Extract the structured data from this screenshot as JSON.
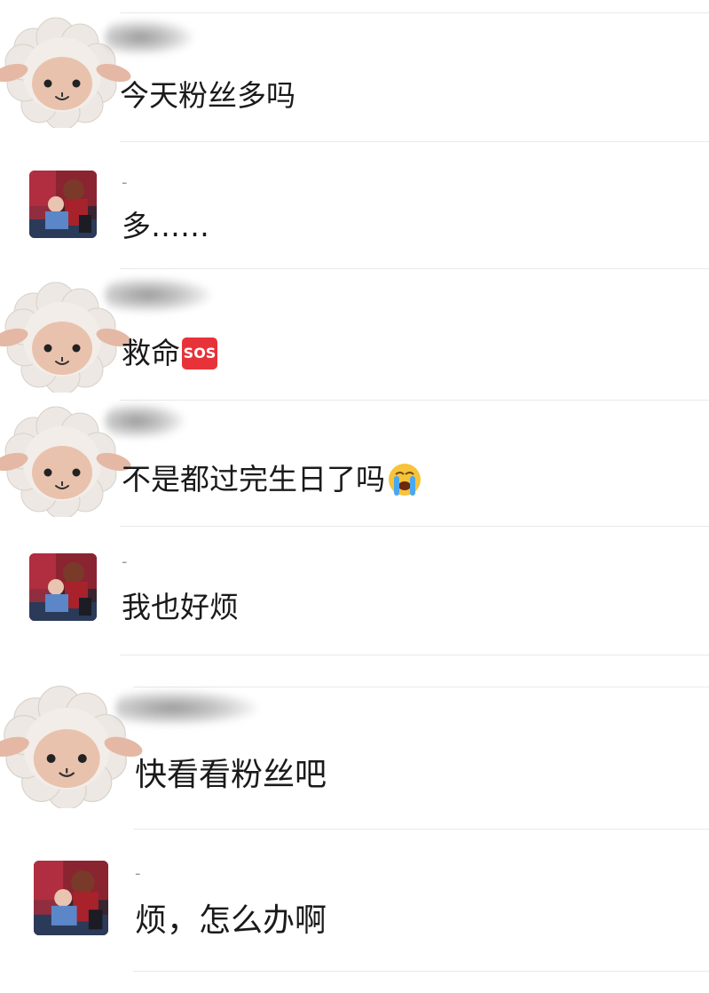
{
  "messages": [
    {
      "text": "今天粉丝多吗",
      "emoji": null
    },
    {
      "name": "-",
      "text": "多……",
      "emoji": null
    },
    {
      "text": "救命",
      "emoji": "SOS"
    },
    {
      "text": "不是都过完生日了吗",
      "emoji": "loudly-crying-face"
    },
    {
      "name": "-",
      "text": "我也好烦",
      "emoji": null
    },
    {
      "text": "快看看粉丝吧",
      "emoji": null
    },
    {
      "name": "-",
      "text": "烦，怎么办啊",
      "emoji": null
    }
  ],
  "colors": {
    "background": "#ffffff",
    "divider": "#e9e9e9",
    "sos": "#e8323a",
    "text": "#1a1a1a"
  }
}
